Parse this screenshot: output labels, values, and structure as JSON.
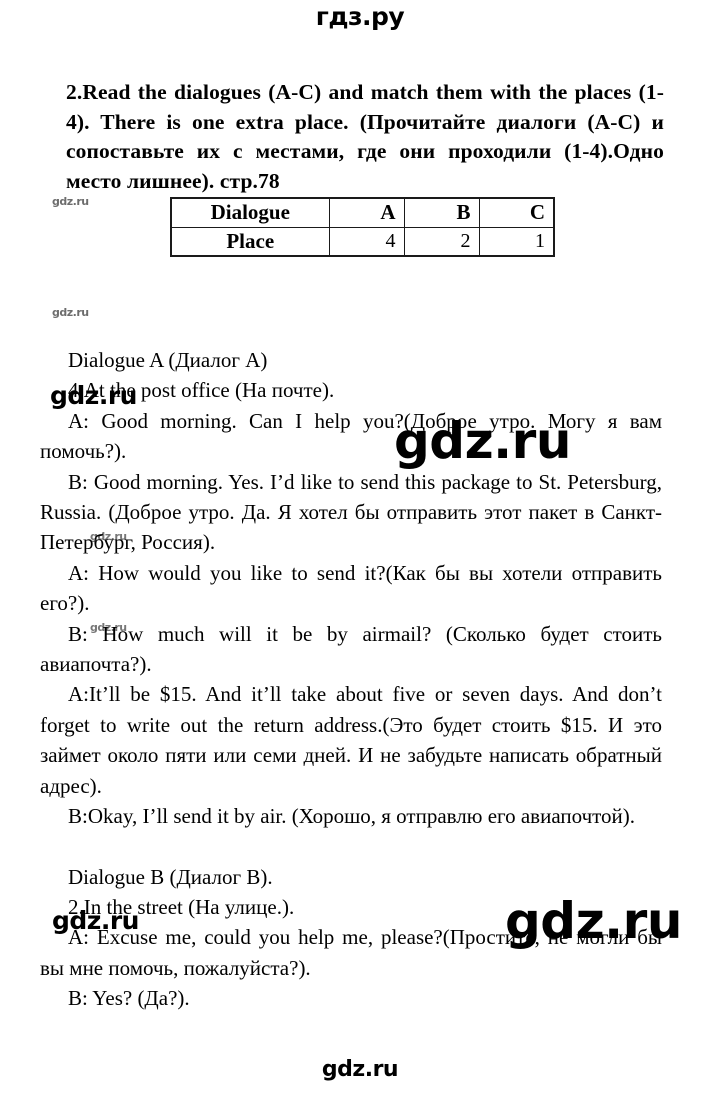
{
  "site": {
    "logo_top": "гдз.ру",
    "logo_bottom": "gdz.ru",
    "watermark": "gdz.ru"
  },
  "task": {
    "heading": "2.Read the dialogues (A-C) and match them with the places (1-4). There is one extra place. (Прочитайте диалоги (A-C) и сопоставьте их с местами, где они проходили (1-4).Одно место лишнее). стр.78"
  },
  "answer_table": {
    "row_labels": [
      "Dialogue",
      "Place"
    ],
    "dialogues": [
      "A",
      "B",
      "C"
    ],
    "places": [
      "4",
      "2",
      "1"
    ]
  },
  "content": {
    "paragraphs": [
      "Dialogue A (Диалог A)",
      "4.At the post office (На почте).",
      "A: Good morning. Can I help you?(Доброе утро. Могу я вам помочь?).",
      "B: Good morning. Yes. I’d like to send this package to St. Petersburg, Russia. (Доброе утро. Да. Я хотел бы отправить этот пакет в Санкт-Петербург, Россия).",
      "A: How would you like to send it?(Как бы вы хотели отправить его?).",
      "B: How much will it be by airmail? (Сколько будет стоить авиапочта?).",
      "A:It’ll be $15. And it’ll take about five or seven days. And don’t forget to write out the return address.(Это будет стоить $15. И это займет около пяти или семи дней. И не забудьте написать обратный адрес).",
      "B:Okay, I’ll send it by air. (Хорошо, я отправлю его авиапочтой).",
      "Dialogue B (Диалог B).",
      "2.In the street (На улице.).",
      "A: Excuse me, could you help me, please?(Простите, не могли бы вы мне помочь, пожалуйста?).",
      "B: Yes? (Да?)."
    ]
  }
}
